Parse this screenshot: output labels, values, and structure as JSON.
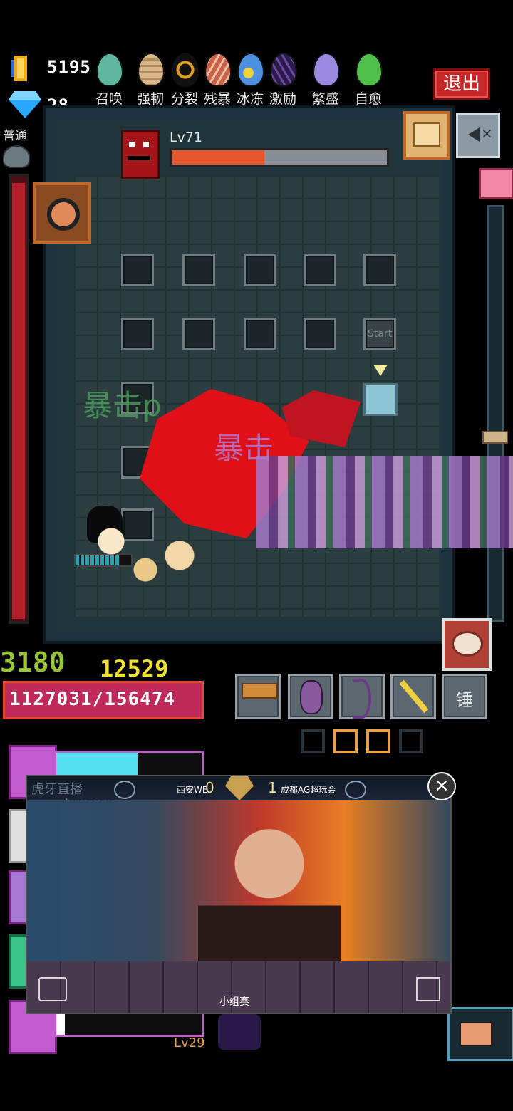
{
  "resources": {
    "gold": "5195",
    "gems": "28"
  },
  "eggs": [
    {
      "label": "召唤",
      "color": "#5fb7a0"
    },
    {
      "label": "强韧",
      "color": "#d9b98c"
    },
    {
      "label": "分裂",
      "color": "#e0a020"
    },
    {
      "label": "残暴",
      "color": "#c8624a"
    },
    {
      "label": "冰冻",
      "color": "#4d8fe0"
    },
    {
      "label": "激励",
      "color": "#4a2f7a"
    },
    {
      "label": "繁盛",
      "color": "#9a8ae0"
    },
    {
      "label": "自愈",
      "color": "#4fbf4a"
    }
  ],
  "exit_label": "退出",
  "difficulty": "普通",
  "boss": {
    "level": "Lv71",
    "hp_fraction": 0.43
  },
  "start_label": "Start",
  "combat_texts": [
    "暴击p",
    "暴击"
  ],
  "damage": {
    "yellow": "12529",
    "green": "3180",
    "total": "1127031/156474"
  },
  "weapons": [
    {
      "name": "hammer-icon"
    },
    {
      "name": "rune-stone-icon"
    },
    {
      "name": "bow-icon"
    },
    {
      "name": "magic-wand-icon"
    }
  ],
  "hammer_button_label": "锤",
  "player": {
    "level": "Lv29"
  },
  "stream": {
    "team_left": "西安WE",
    "score_left": "0",
    "score_right": "1",
    "team_right": "成都AG超玩会",
    "watermark": "虎牙直播",
    "watermark_url": "huya.com",
    "banner_text": "小组赛"
  },
  "colors": {
    "accent_red": "#c62828",
    "hp_orange": "#e4572e",
    "pink": "#c45ad0",
    "cyan": "#54e0f0"
  }
}
